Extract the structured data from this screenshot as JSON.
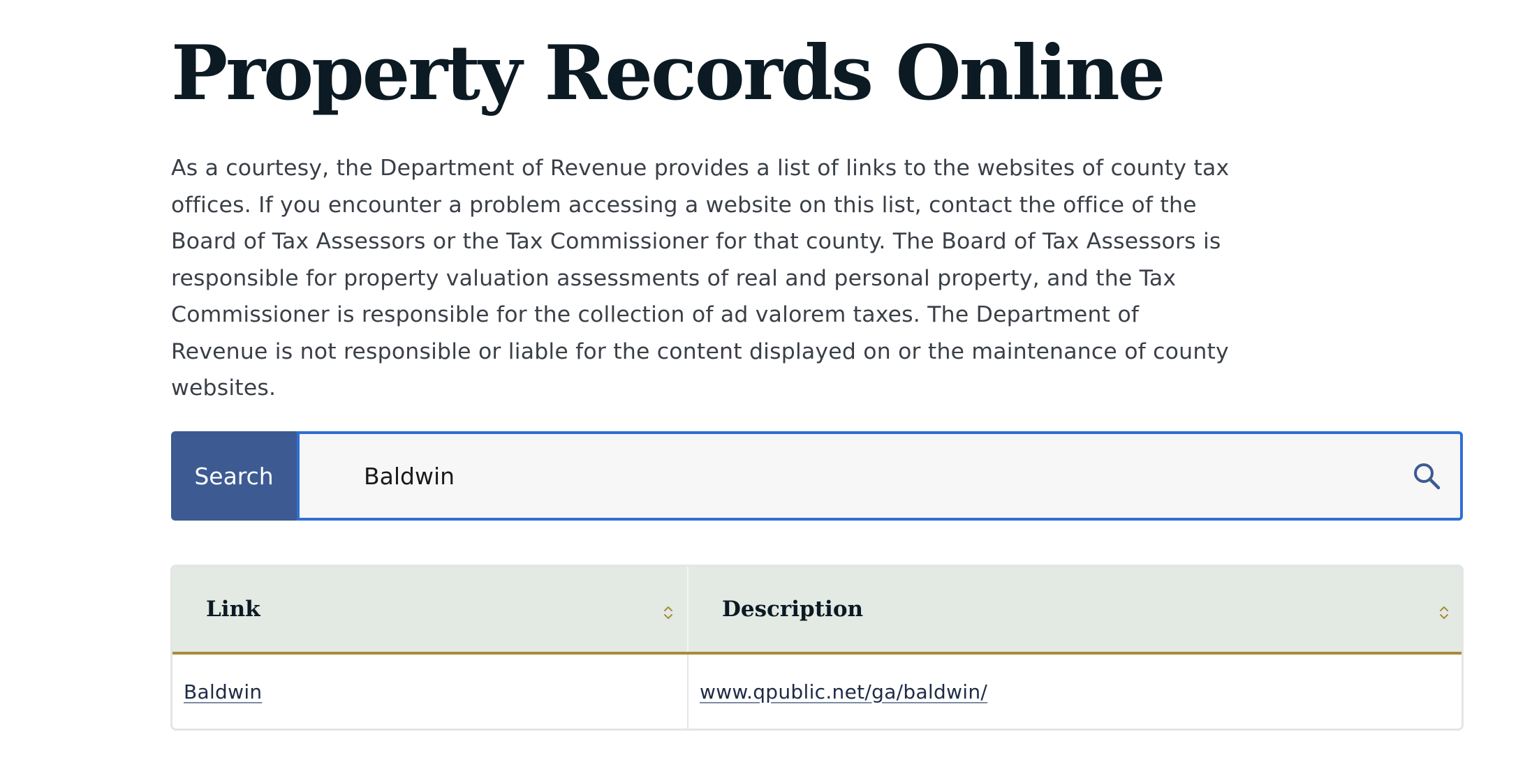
{
  "page": {
    "title": "Property Records Online",
    "intro": "As a courtesy, the Department of Revenue provides a list of links to the websites of county tax offices. If you encounter a problem accessing a website on this list, contact the office of the Board of Tax Assessors or the Tax Commissioner for that county. The Board of Tax Assessors is responsible for property valuation assessments of real and personal property, and the Tax Commissioner is responsible for the collection of ad valorem taxes. The Department of Revenue is not responsible or liable for the content displayed on or the maintenance of county websites."
  },
  "search": {
    "label": "Search",
    "value": "Baldwin",
    "icon": "search-icon"
  },
  "table": {
    "columns": [
      {
        "label": "Link",
        "icon": "sort-icon"
      },
      {
        "label": "Description",
        "icon": "sort-icon"
      }
    ],
    "rows": [
      {
        "link": "Baldwin",
        "description": "www.qpublic.net/ga/baldwin/"
      }
    ]
  },
  "colors": {
    "title": "#0b1a23",
    "search_label_bg": "#3d5a92",
    "search_focus_border": "#2f6fd6",
    "table_header_bg": "#e3e9e3",
    "table_header_rule": "#a98b3c",
    "link": "#1d2b45"
  }
}
